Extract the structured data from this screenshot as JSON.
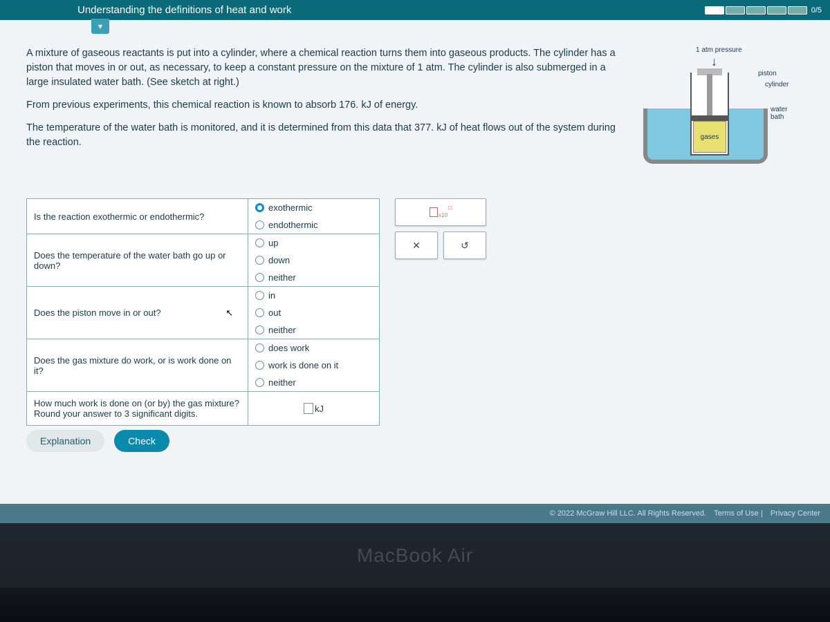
{
  "header": {
    "title": "Understanding the definitions of heat and work",
    "progress": "0/5"
  },
  "problem": {
    "p1": "A mixture of gaseous reactants is put into a cylinder, where a chemical reaction turns them into gaseous products. The cylinder has a piston that moves in or out, as necessary, to keep a constant pressure on the mixture of 1 atm. The cylinder is also submerged in a large insulated water bath. (See sketch at right.)",
    "p2": "From previous experiments, this chemical reaction is known to absorb 176. kJ of energy.",
    "p3": "The temperature of the water bath is monitored, and it is determined from this data that 377. kJ of heat flows out of the system during the reaction."
  },
  "diagram": {
    "pressure": "1 atm pressure",
    "piston": "piston",
    "cylinder": "cylinder",
    "waterbath": "water bath",
    "gases": "gases"
  },
  "questions": [
    {
      "q": "Is the reaction exothermic or endothermic?",
      "opts": [
        "exothermic",
        "endothermic"
      ],
      "selected": 0
    },
    {
      "q": "Does the temperature of the water bath go up or down?",
      "opts": [
        "up",
        "down",
        "neither"
      ],
      "selected": -1
    },
    {
      "q": "Does the piston move in or out?",
      "opts": [
        "in",
        "out",
        "neither"
      ],
      "selected": -1
    },
    {
      "q": "Does the gas mixture do work, or is work done on it?",
      "opts": [
        "does work",
        "work is done on it",
        "neither"
      ],
      "selected": -1
    },
    {
      "q": "How much work is done on (or by) the gas mixture? Round your answer to 3 significant digits.",
      "unit": "kJ"
    }
  ],
  "tools": {
    "x10": "x10",
    "clear": "✕",
    "reset": "↺"
  },
  "buttons": {
    "explanation": "Explanation",
    "check": "Check"
  },
  "footer": {
    "copyright": "© 2022 McGraw Hill LLC. All Rights Reserved.",
    "terms": "Terms of Use",
    "privacy": "Privacy Center"
  },
  "laptop": "MacBook Air"
}
